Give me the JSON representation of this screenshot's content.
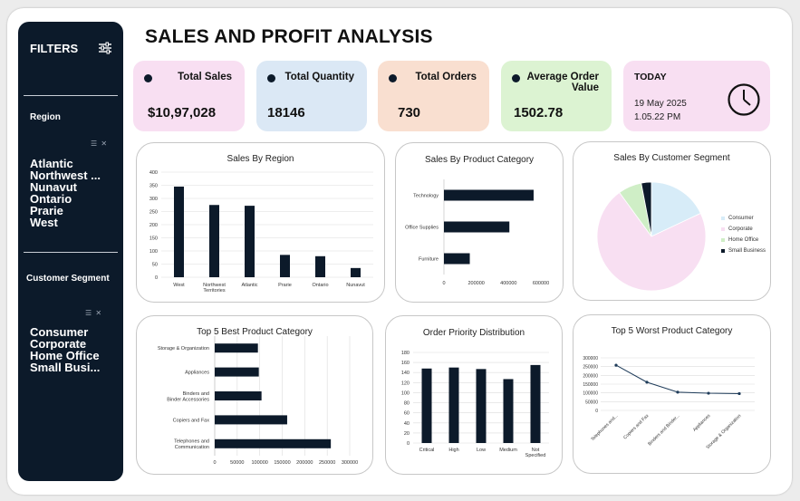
{
  "title": "SALES AND PROFIT ANALYSIS",
  "sidebar": {
    "title": "FILTERS",
    "region_heading": "Region",
    "regions": [
      "Atlantic",
      "Northwest ...",
      "Nunavut",
      "Ontario",
      "Prarie",
      "West"
    ],
    "segment_heading": "Customer Segment",
    "segments": [
      "Consumer",
      "Corporate",
      "Home Office",
      "Small Busi..."
    ]
  },
  "kpis": {
    "total_sales": {
      "label": "Total Sales",
      "value": "$10,97,028",
      "color": "#f8dff2"
    },
    "total_quantity": {
      "label": "Total Quantity",
      "value": "18146",
      "color": "#dbe8f5"
    },
    "total_orders": {
      "label": "Total Orders",
      "value": "730",
      "color": "#f9dfd0"
    },
    "avg_order_value": {
      "label": "Average Order Value",
      "value": "1502.78",
      "color": "#dcf3d2"
    }
  },
  "today": {
    "label": "TODAY",
    "date": "19 May 2025",
    "time": "1.05.22 PM",
    "color": "#f8dff2",
    "icon": "clock-icon"
  },
  "chart_data": [
    {
      "id": "sales_by_region",
      "type": "bar",
      "title": "Sales By Region",
      "categories": [
        "West",
        "Northwest Territories",
        "Atlantic",
        "Prarie",
        "Ontario",
        "Nunavut"
      ],
      "values": [
        345,
        275,
        272,
        85,
        80,
        35
      ],
      "ylim": [
        0,
        400
      ],
      "yticks": [
        0,
        50,
        100,
        150,
        200,
        250,
        300,
        350,
        400
      ],
      "grid": true
    },
    {
      "id": "sales_by_product_category",
      "type": "bar",
      "orientation": "horizontal",
      "title": "Sales By Product Category",
      "categories": [
        "Technology",
        "Office Supplies",
        "Furniture"
      ],
      "values": [
        555000,
        405000,
        160000
      ],
      "xlim": [
        0,
        600000
      ],
      "xticks": [
        "0",
        "200000",
        "400000",
        "600000"
      ],
      "grid": false
    },
    {
      "id": "sales_by_customer_segment",
      "type": "pie",
      "title": "Sales By Customer Segment",
      "categories": [
        "Consumer",
        "Corporate",
        "Home Office",
        "Small Business"
      ],
      "values": [
        18,
        72,
        7,
        3
      ],
      "colors": [
        "#d7ecf8",
        "#f8dff2",
        "#cfeec6",
        "#0c1a2a"
      ],
      "legend": "right"
    },
    {
      "id": "top5_best_product_category",
      "type": "bar",
      "orientation": "horizontal",
      "title": "Top 5 Best Product Category",
      "categories": [
        "Storage & Organization",
        "Appliances",
        "Binders and Binder Accessories",
        "Copiers and Fax",
        "Telephones and Communication"
      ],
      "values": [
        96000,
        98000,
        104000,
        161000,
        258000
      ],
      "xlim": [
        0,
        300000
      ],
      "xticks": [
        "0",
        "50000",
        "100000",
        "150000",
        "200000",
        "250000",
        "300000"
      ],
      "grid": true
    },
    {
      "id": "order_priority_distribution",
      "type": "bar",
      "title": "Order Priority Distribution",
      "categories": [
        "Critical",
        "High",
        "Low",
        "Medium",
        "Not Specified"
      ],
      "values": [
        148,
        150,
        147,
        127,
        155
      ],
      "ylim": [
        0,
        180
      ],
      "yticks": [
        0,
        20,
        40,
        60,
        80,
        100,
        120,
        140,
        160,
        180
      ],
      "grid": true
    },
    {
      "id": "top5_worst_product_category",
      "type": "line",
      "title": "Top 5 Worst Product Category",
      "categories": [
        "Telephones and...",
        "Copiers and Fax",
        "Binders and Binder...",
        "Appliances",
        "Storage & Organization"
      ],
      "values": [
        258000,
        161000,
        104000,
        98000,
        96000
      ],
      "ylim": [
        0,
        300000
      ],
      "yticks": [
        "0",
        "50000",
        "100000",
        "150000",
        "200000",
        "250000",
        "300000"
      ],
      "grid": true
    }
  ]
}
